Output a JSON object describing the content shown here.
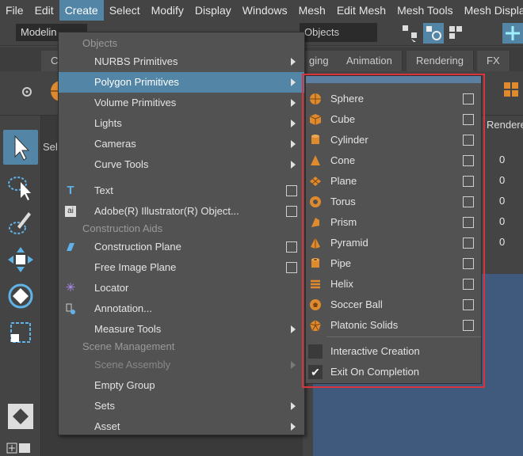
{
  "menubar": [
    "File",
    "Edit",
    "Create",
    "Select",
    "Modify",
    "Display",
    "Windows",
    "Mesh",
    "Edit Mesh",
    "Mesh Tools",
    "Mesh Display"
  ],
  "toolrow": {
    "mode": "Modelin",
    "objects_field": "Objects"
  },
  "shelf_tabs": [
    "C",
    "ging",
    "Animation",
    "Rendering",
    "FX"
  ],
  "panel": {
    "select_label": "Sel"
  },
  "channel": {
    "header": "Rendere",
    "values": [
      "0",
      "0",
      "0",
      "0",
      "0"
    ]
  },
  "create_menu": {
    "section_objects": "Objects",
    "nurbs": "NURBS Primitives",
    "polygon": "Polygon Primitives",
    "volume": "Volume Primitives",
    "lights": "Lights",
    "cameras": "Cameras",
    "curve_tools": "Curve Tools",
    "text": "Text",
    "illustrator": "Adobe(R) Illustrator(R) Object...",
    "section_construction": "Construction Aids",
    "construction_plane": "Construction Plane",
    "free_image_plane": "Free Image Plane",
    "locator": "Locator",
    "annotation": "Annotation...",
    "measure_tools": "Measure Tools",
    "section_scene": "Scene Management",
    "scene_assembly": "Scene Assembly",
    "empty_group": "Empty Group",
    "sets": "Sets",
    "asset": "Asset"
  },
  "polygon_submenu": {
    "items": [
      "Sphere",
      "Cube",
      "Cylinder",
      "Cone",
      "Plane",
      "Torus",
      "Prism",
      "Pyramid",
      "Pipe",
      "Helix",
      "Soccer Ball",
      "Platonic Solids"
    ],
    "interactive_creation": "Interactive Creation",
    "exit_on_completion": "Exit On Completion",
    "exit_on_completion_checked": true
  },
  "colors": {
    "highlight": "#5285a6",
    "annotation_red": "#d9343e",
    "primitive_orange": "#e08a2e"
  }
}
